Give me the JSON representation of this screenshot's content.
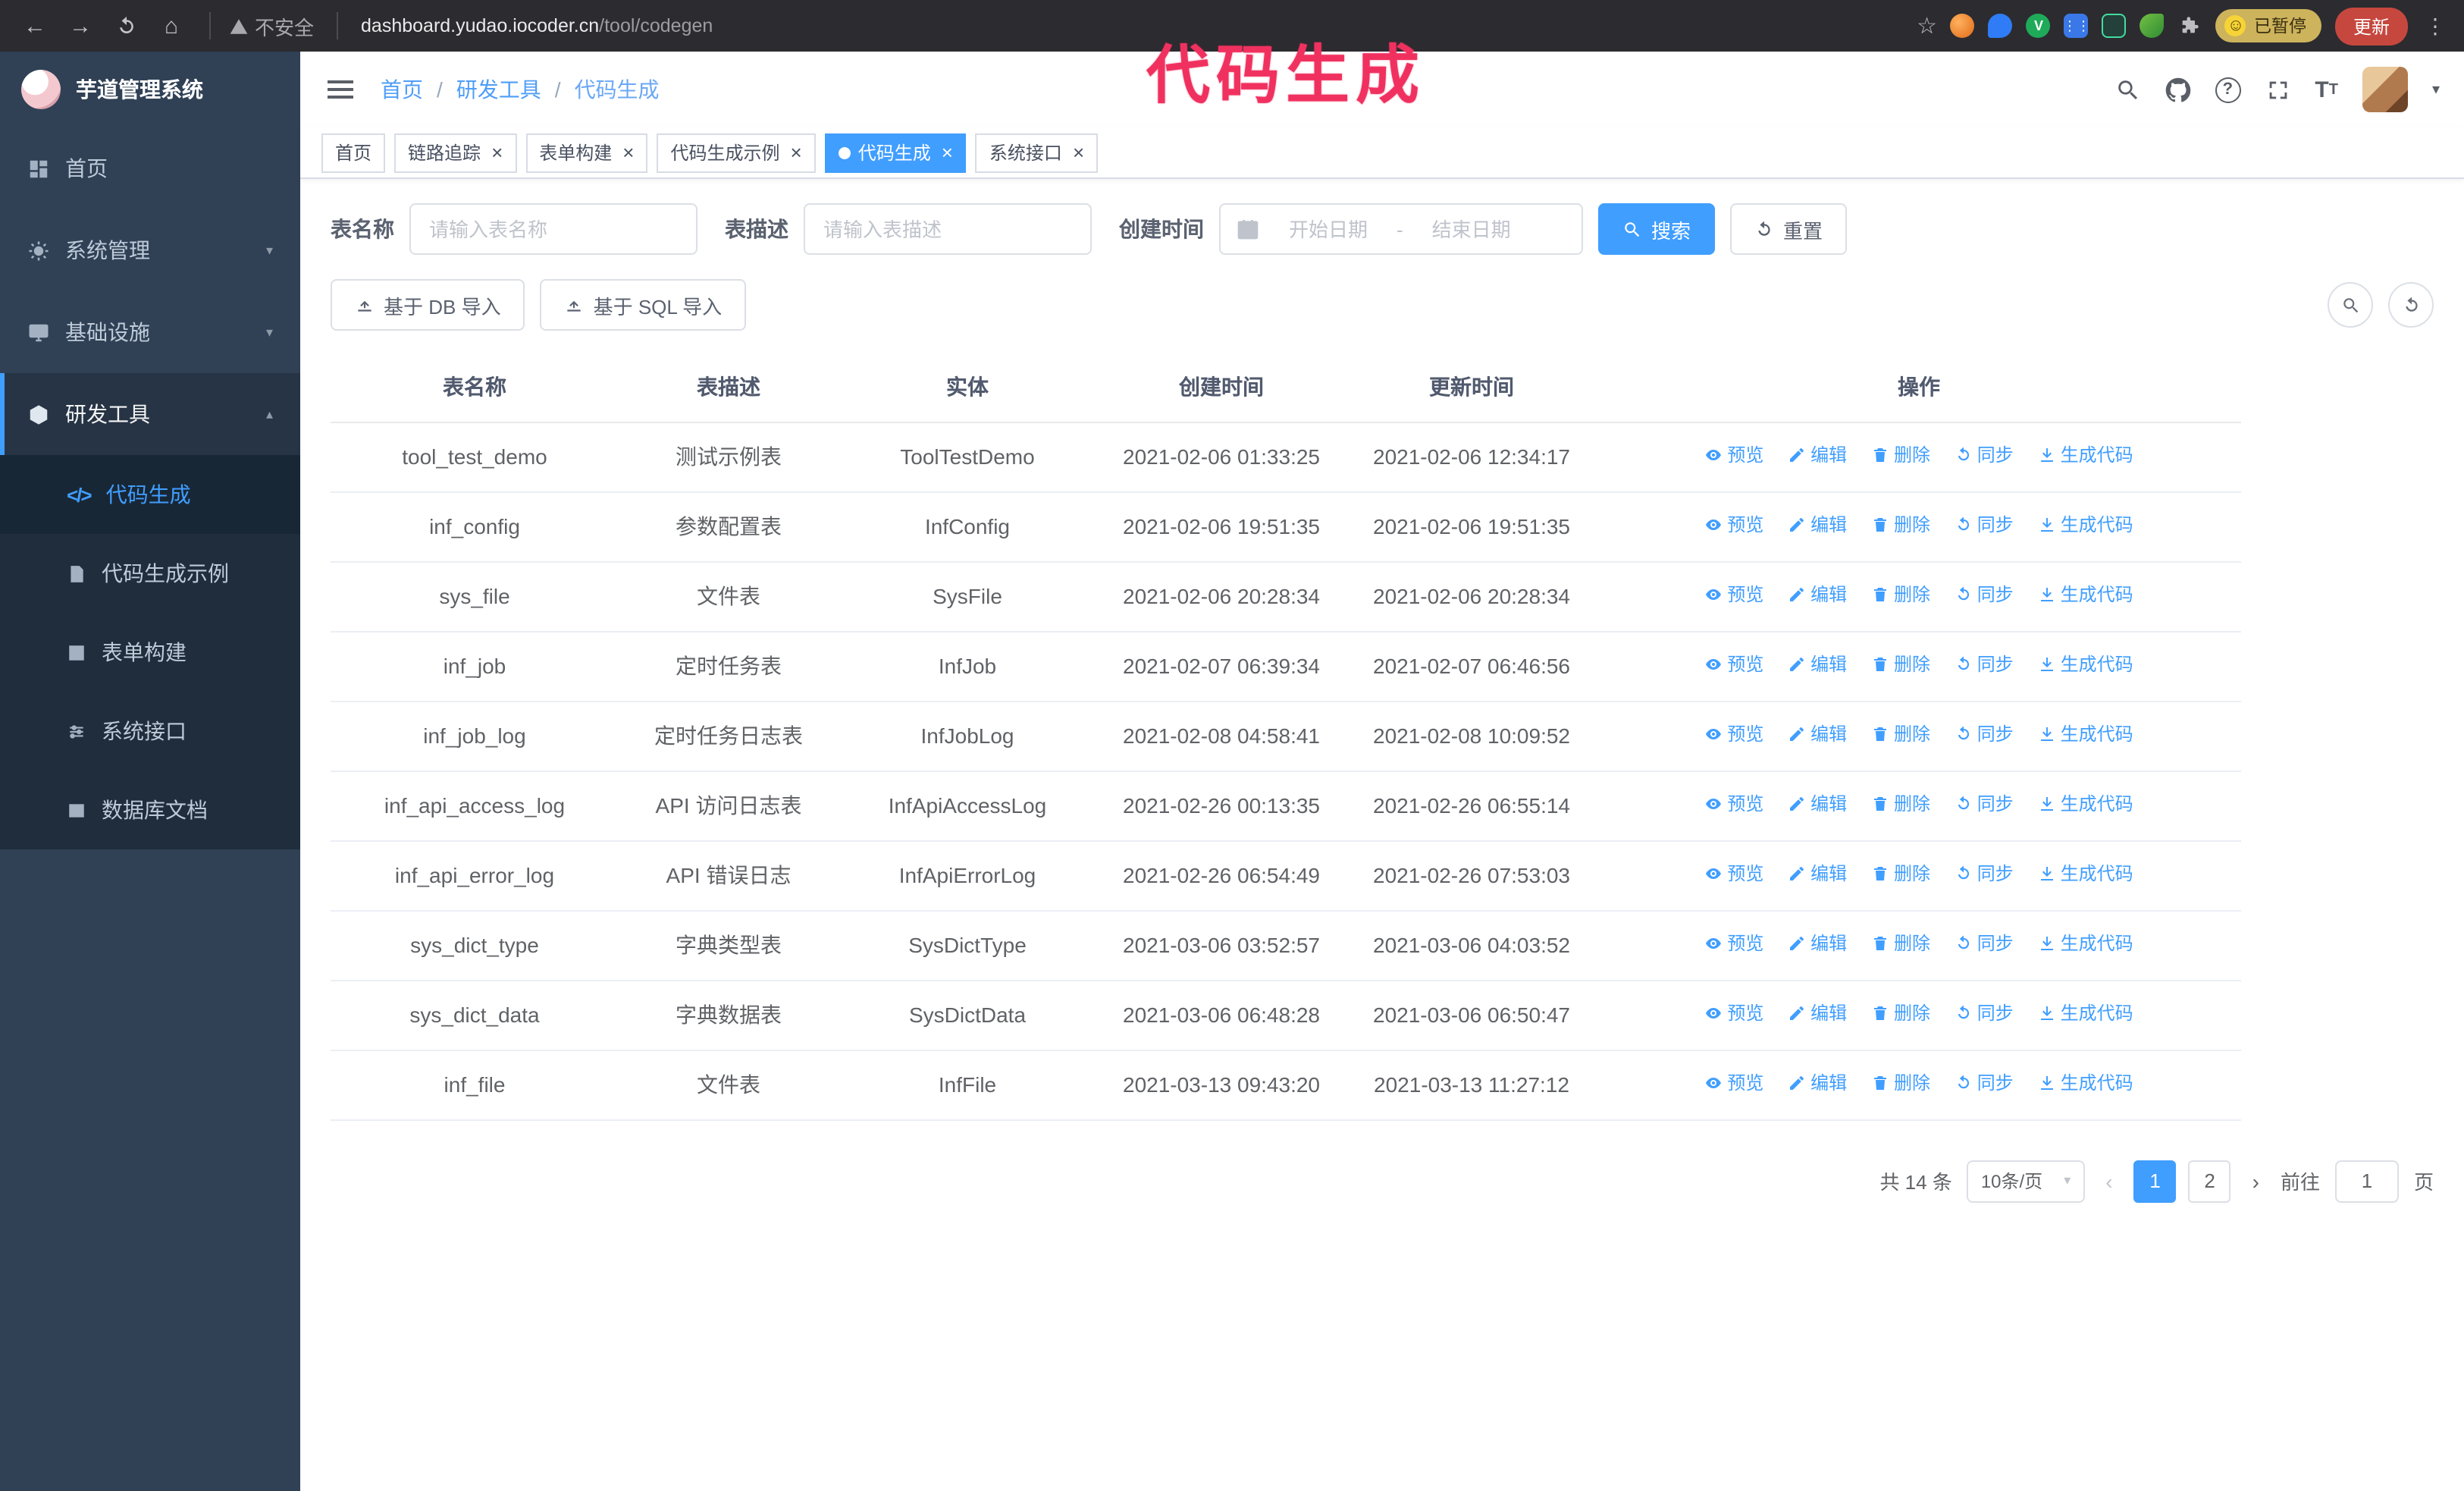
{
  "theme": {
    "primary": "#409eff",
    "chrome_bg": "#2b2b30",
    "sidebar_bg": "#304156",
    "submenu_bg": "#1f2d3d",
    "annotation_color": "#f0315f",
    "update_button_bg": "#c6473e",
    "paused_badge_bg": "#cdb35c"
  },
  "browser": {
    "security_label": "不安全",
    "url_host": "dashboard.yudao.iocoder.cn",
    "url_path": "/tool/codegen",
    "paused_badge": "已暂停",
    "update_button": "更新"
  },
  "annotation": {
    "text": "代码生成"
  },
  "sidebar": {
    "logo_title": "芋道管理系统",
    "items": [
      {
        "label": "首页"
      },
      {
        "label": "系统管理"
      },
      {
        "label": "基础设施"
      },
      {
        "label": "研发工具"
      }
    ],
    "sub_items": [
      {
        "label": "代码生成"
      },
      {
        "label": "代码生成示例"
      },
      {
        "label": "表单构建"
      },
      {
        "label": "系统接口"
      },
      {
        "label": "数据库文档"
      }
    ]
  },
  "header": {
    "breadcrumb": [
      "首页",
      "研发工具",
      "代码生成"
    ],
    "breadcrumb_separator": "/"
  },
  "tabs": [
    {
      "label": "首页",
      "closable": false,
      "active": false
    },
    {
      "label": "链路追踪",
      "closable": true,
      "active": false
    },
    {
      "label": "表单构建",
      "closable": true,
      "active": false
    },
    {
      "label": "代码生成示例",
      "closable": true,
      "active": false
    },
    {
      "label": "代码生成",
      "closable": true,
      "active": true
    },
    {
      "label": "系统接口",
      "closable": true,
      "active": false
    }
  ],
  "filters": {
    "table_name_label": "表名称",
    "table_name_placeholder": "请输入表名称",
    "table_desc_label": "表描述",
    "table_desc_placeholder": "请输入表描述",
    "create_time_label": "创建时间",
    "date_start_placeholder": "开始日期",
    "date_separator": "-",
    "date_end_placeholder": "结束日期",
    "search_button": "搜索",
    "reset_button": "重置"
  },
  "toolbar": {
    "import_db_button": "基于 DB 导入",
    "import_sql_button": "基于 SQL 导入"
  },
  "table": {
    "columns": [
      "表名称",
      "表描述",
      "实体",
      "创建时间",
      "更新时间",
      "操作"
    ],
    "actions": [
      "预览",
      "编辑",
      "删除",
      "同步",
      "生成代码"
    ],
    "rows": [
      {
        "name": "tool_test_demo",
        "desc": "测试示例表",
        "entity": "ToolTestDemo",
        "created": "2021-02-06 01:33:25",
        "updated": "2021-02-06 12:34:17"
      },
      {
        "name": "inf_config",
        "desc": "参数配置表",
        "entity": "InfConfig",
        "created": "2021-02-06 19:51:35",
        "updated": "2021-02-06 19:51:35"
      },
      {
        "name": "sys_file",
        "desc": "文件表",
        "entity": "SysFile",
        "created": "2021-02-06 20:28:34",
        "updated": "2021-02-06 20:28:34"
      },
      {
        "name": "inf_job",
        "desc": "定时任务表",
        "entity": "InfJob",
        "created": "2021-02-07 06:39:34",
        "updated": "2021-02-07 06:46:56"
      },
      {
        "name": "inf_job_log",
        "desc": "定时任务日志表",
        "entity": "InfJobLog",
        "created": "2021-02-08 04:58:41",
        "updated": "2021-02-08 10:09:52"
      },
      {
        "name": "inf_api_access_log",
        "desc": "API 访问日志表",
        "entity": "InfApiAccessLog",
        "created": "2021-02-26 00:13:35",
        "updated": "2021-02-26 06:55:14"
      },
      {
        "name": "inf_api_error_log",
        "desc": "API 错误日志",
        "entity": "InfApiErrorLog",
        "created": "2021-02-26 06:54:49",
        "updated": "2021-02-26 07:53:03"
      },
      {
        "name": "sys_dict_type",
        "desc": "字典类型表",
        "entity": "SysDictType",
        "created": "2021-03-06 03:52:57",
        "updated": "2021-03-06 04:03:52"
      },
      {
        "name": "sys_dict_data",
        "desc": "字典数据表",
        "entity": "SysDictData",
        "created": "2021-03-06 06:48:28",
        "updated": "2021-03-06 06:50:47"
      },
      {
        "name": "inf_file",
        "desc": "文件表",
        "entity": "InfFile",
        "created": "2021-03-13 09:43:20",
        "updated": "2021-03-13 11:27:12"
      }
    ]
  },
  "pagination": {
    "total": "共 14 条",
    "page_size": "10条/页",
    "pages": [
      "1",
      "2"
    ],
    "active_page": "1",
    "goto_label": "前往",
    "goto_value": "1",
    "goto_unit": "页"
  }
}
